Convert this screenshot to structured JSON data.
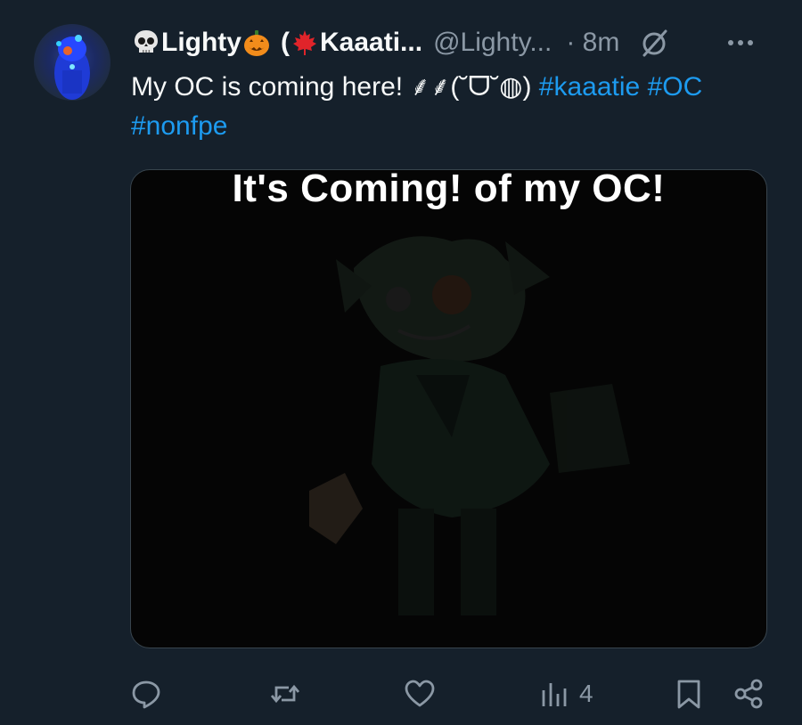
{
  "tweet": {
    "display_name_part1": "Lighty",
    "display_name_part2": "(",
    "display_name_part3": "Kaaati...",
    "handle": "@Lighty...",
    "time": "· 8m",
    "text_main": "My OC is coming here! ⸙⸙(˘ᗜ˘◍) ",
    "hashtags": [
      "#kaaatie",
      "#OC",
      "#nonfpe"
    ],
    "media_caption": "It's Coming! of my OC!",
    "views_count": "4"
  },
  "colors": {
    "background": "#15202b",
    "text": "#f7f9f9",
    "muted": "#8b98a5",
    "link": "#1d9bf0",
    "border": "#38444d"
  },
  "icons": {
    "skull": "skull-emoji",
    "pumpkin": "jack-o-lantern-emoji",
    "maple": "maple-leaf-emoji",
    "grok": "grok-icon",
    "more": "more-icon",
    "reply": "reply-icon",
    "retweet": "retweet-icon",
    "like": "heart-icon",
    "views": "views-icon",
    "bookmark": "bookmark-icon",
    "share": "share-icon"
  }
}
